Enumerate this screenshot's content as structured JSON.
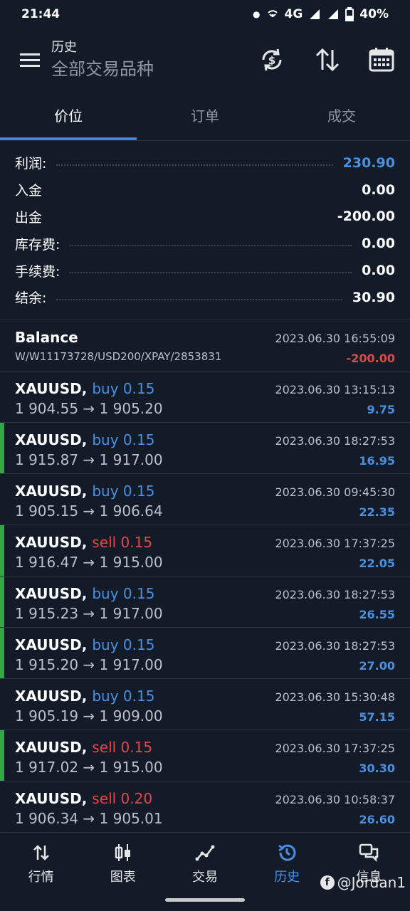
{
  "status": {
    "time": "21:44",
    "network": "4G",
    "battery": "40%"
  },
  "header": {
    "title": "历史",
    "subtitle": "全部交易品种",
    "actions": [
      "currency-exchange-icon",
      "sort-icon",
      "calendar-icon"
    ]
  },
  "tabs": [
    {
      "label": "价位",
      "active": true
    },
    {
      "label": "订单",
      "active": false
    },
    {
      "label": "成交",
      "active": false
    }
  ],
  "summary": [
    {
      "label": "利润:",
      "value": "230.90",
      "color": "#4a90e2",
      "dots": true
    },
    {
      "label": "入金",
      "value": "0.00",
      "color": "#ffffff",
      "dots": false
    },
    {
      "label": "出金",
      "value": "-200.00",
      "color": "#ffffff",
      "dots": false
    },
    {
      "label": "库存费:",
      "value": "0.00",
      "color": "#ffffff",
      "dots": true
    },
    {
      "label": "手续费:",
      "value": "0.00",
      "color": "#ffffff",
      "dots": true
    },
    {
      "label": "结余:",
      "value": "30.90",
      "color": "#ffffff",
      "dots": true
    }
  ],
  "balance_entry": {
    "title": "Balance",
    "comment": "W/W11173728/USD200/XPAY/2853831",
    "time": "2023.06.30 16:55:09",
    "amount": "-200.00",
    "amount_color": "#e04848"
  },
  "trades": [
    {
      "symbol": "XAUUSD,",
      "side": "buy 0.15",
      "open": "1 904.55",
      "close": "1 905.20",
      "time": "2023.06.30 13:15:13",
      "profit": "9.75",
      "stripe": false
    },
    {
      "symbol": "XAUUSD,",
      "side": "buy 0.15",
      "open": "1 915.87",
      "close": "1 917.00",
      "time": "2023.06.30 18:27:53",
      "profit": "16.95",
      "stripe": true
    },
    {
      "symbol": "XAUUSD,",
      "side": "buy 0.15",
      "open": "1 905.15",
      "close": "1 906.64",
      "time": "2023.06.30 09:45:30",
      "profit": "22.35",
      "stripe": false
    },
    {
      "symbol": "XAUUSD,",
      "side": "sell 0.15",
      "open": "1 916.47",
      "close": "1 915.00",
      "time": "2023.06.30 17:37:25",
      "profit": "22.05",
      "stripe": true
    },
    {
      "symbol": "XAUUSD,",
      "side": "buy 0.15",
      "open": "1 915.23",
      "close": "1 917.00",
      "time": "2023.06.30 18:27:53",
      "profit": "26.55",
      "stripe": true
    },
    {
      "symbol": "XAUUSD,",
      "side": "buy 0.15",
      "open": "1 915.20",
      "close": "1 917.00",
      "time": "2023.06.30 18:27:53",
      "profit": "27.00",
      "stripe": true
    },
    {
      "symbol": "XAUUSD,",
      "side": "buy 0.15",
      "open": "1 905.19",
      "close": "1 909.00",
      "time": "2023.06.30 15:30:48",
      "profit": "57.15",
      "stripe": false
    },
    {
      "symbol": "XAUUSD,",
      "side": "sell 0.15",
      "open": "1 917.02",
      "close": "1 915.00",
      "time": "2023.06.30 17:37:25",
      "profit": "30.30",
      "stripe": true
    },
    {
      "symbol": "XAUUSD,",
      "side": "sell 0.20",
      "open": "1 906.34",
      "close": "1 905.01",
      "time": "2023.06.30 10:58:37",
      "profit": "26.60",
      "stripe": false
    }
  ],
  "arrow_glyph": "→",
  "profit_color": "#4a90e2",
  "bottom_nav": [
    {
      "label": "行情",
      "icon": "quotes-icon",
      "active": false
    },
    {
      "label": "图表",
      "icon": "chart-icon",
      "active": false
    },
    {
      "label": "交易",
      "icon": "trade-icon",
      "active": false
    },
    {
      "label": "历史",
      "icon": "history-icon",
      "active": true
    },
    {
      "label": "信息",
      "icon": "messages-icon",
      "active": false
    }
  ],
  "watermark": "@Jordan1"
}
